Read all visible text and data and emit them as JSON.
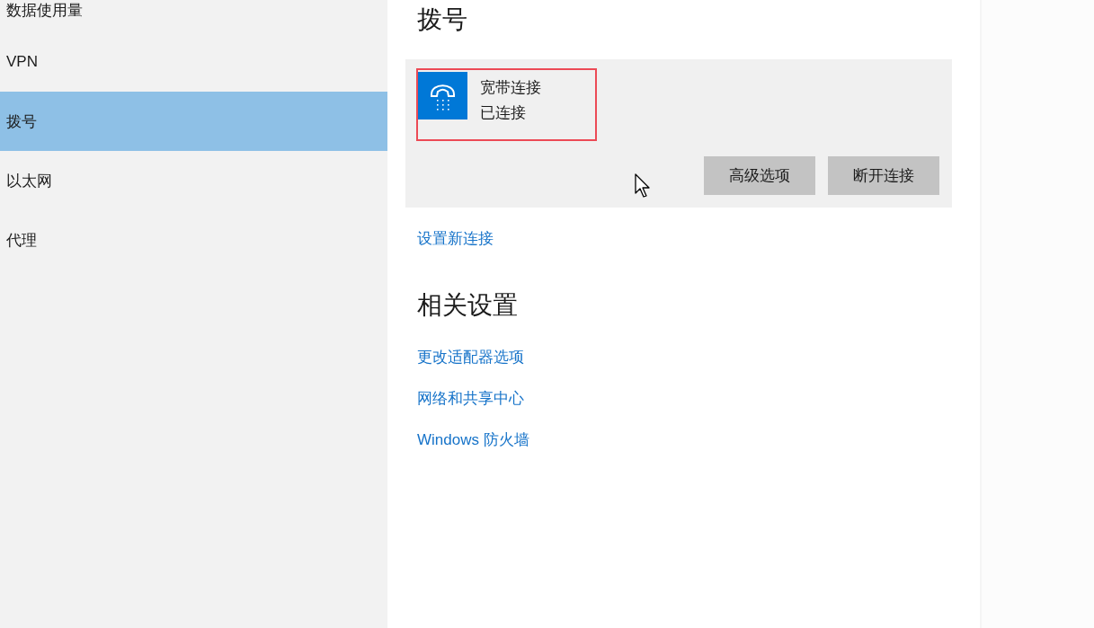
{
  "sidebar": {
    "items": [
      {
        "label": "数据使用量",
        "selected": false
      },
      {
        "label": "VPN",
        "selected": false
      },
      {
        "label": "拨号",
        "selected": true
      },
      {
        "label": "以太网",
        "selected": false
      },
      {
        "label": "代理",
        "selected": false
      }
    ]
  },
  "dialup": {
    "title": "拨号",
    "connection": {
      "name": "宽带连接",
      "status": "已连接",
      "highlighted": true,
      "buttons": [
        "高级选项",
        "断开连接"
      ]
    },
    "new_connection_link": "设置新连接"
  },
  "related_settings": {
    "title": "相关设置",
    "links": [
      "更改适配器选项",
      "网络和共享中心",
      "Windows 防火墙"
    ]
  }
}
